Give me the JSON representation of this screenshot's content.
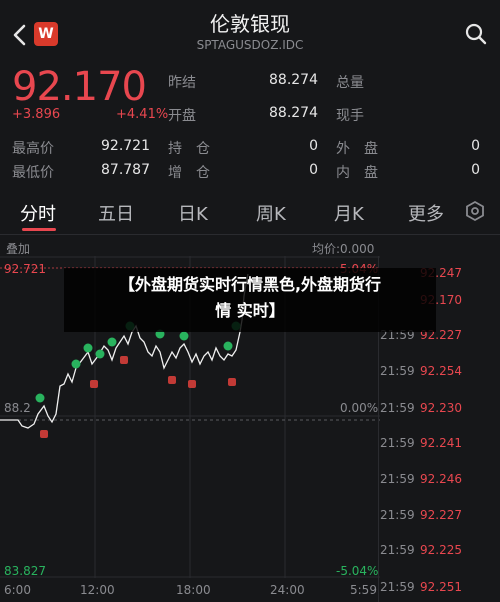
{
  "header": {
    "title": "伦敦银现",
    "subtitle": "SPTAGUSDOZ.IDC",
    "logo_text": "W",
    "back_icon": "chevron-left-icon",
    "search_icon": "search-icon"
  },
  "quote": {
    "price": "92.170",
    "change": "+3.896",
    "change_pct": "+4.41%",
    "fields": [
      {
        "label": "昨结",
        "value": "88.274"
      },
      {
        "label": "总量",
        "value": ""
      },
      {
        "label": "开盘",
        "value": "88.274"
      },
      {
        "label": "现手",
        "value": ""
      },
      {
        "label": "最高价",
        "value": "92.721"
      },
      {
        "label": "持　仓",
        "value": "0"
      },
      {
        "label": "外　盘",
        "value": ""
      },
      {
        "label": "最低价",
        "value": "87.787"
      },
      {
        "label": "增　仓",
        "value": "0"
      },
      {
        "label": "内　盘",
        "value": ""
      }
    ],
    "extra_values": {
      "hold": "0",
      "outer": "0",
      "inner": "0",
      "add": "0"
    }
  },
  "tabs": [
    "分时",
    "五日",
    "日K",
    "周K",
    "月K",
    "更多"
  ],
  "chart": {
    "overlay_label": "叠加",
    "avg_label": "均价:0.000",
    "high_price": "92.721",
    "high_pct": "5.04%",
    "mid_price": "88.2",
    "mid_pct": "0.00%",
    "low_price": "83.827",
    "low_pct": "-5.04%",
    "x_labels": [
      "6:00",
      "12:00",
      "18:00",
      "24:00",
      "5:59"
    ]
  },
  "chart_data": {
    "type": "line",
    "x": [
      "6:00",
      "12:00",
      "18:00",
      "24:00",
      "5:59"
    ],
    "ylim": [
      83.827,
      92.721
    ],
    "y_ticks": [
      "92.721",
      "88.2",
      "83.827"
    ],
    "pct_ticks": [
      "5.04%",
      "0.00%",
      "-5.04%"
    ]
  },
  "trades": [
    {
      "time": "",
      "price": "92.247",
      "vol": ""
    },
    {
      "time": "",
      "price": "92.170",
      "vol": ""
    },
    {
      "time": "21:59",
      "price": "92.227",
      "vol": ""
    },
    {
      "time": "21:59",
      "price": "92.254",
      "vol": ""
    },
    {
      "time": "21:59",
      "price": "92.230",
      "vol": ""
    },
    {
      "time": "21:59",
      "price": "92.241",
      "vol": ""
    },
    {
      "time": "21:59",
      "price": "92.246",
      "vol": ""
    },
    {
      "time": "21:59",
      "price": "92.227",
      "vol": ""
    },
    {
      "time": "21:59",
      "price": "92.225",
      "vol": ""
    },
    {
      "time": "21:59",
      "price": "92.251",
      "vol": ""
    }
  ],
  "overlay": {
    "line1": "【外盘期货实时行情黑色,外盘期货行",
    "line2": "情 实时】"
  }
}
